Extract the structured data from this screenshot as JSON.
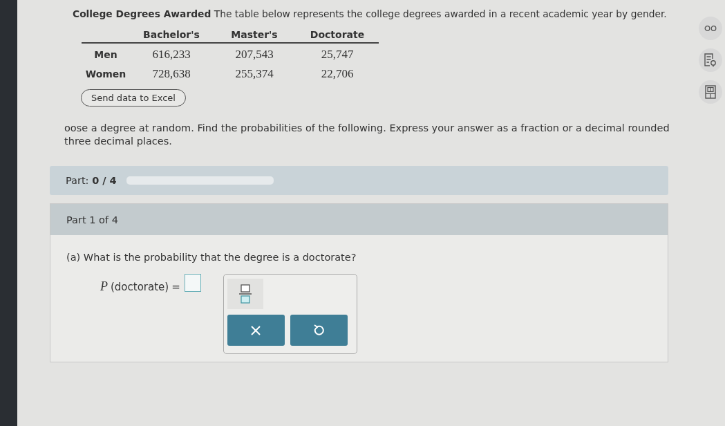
{
  "intro": {
    "title": "College Degrees Awarded",
    "text": "The table below represents the college degrees awarded in a recent academic year by gender."
  },
  "table": {
    "columns": [
      "Bachelor's",
      "Master's",
      "Doctorate"
    ],
    "rows": [
      {
        "label": "Men",
        "cells": [
          "616,233",
          "207,543",
          "25,747"
        ]
      },
      {
        "label": "Women",
        "cells": [
          "728,638",
          "255,374",
          "22,706"
        ]
      }
    ]
  },
  "excel_button": "Send data to Excel",
  "instructions": [
    "oose a degree at random. Find the probabilities of the following. Express your answer as a fraction or a decimal rounded",
    "three decimal places."
  ],
  "progress": {
    "label": "Part:",
    "value": "0 / 4",
    "level": 0
  },
  "part": {
    "title": "Part 1 of 4",
    "question": "(a) What is the probability that the degree is a doctorate?",
    "answer": {
      "function": "P",
      "argument": "(doctorate)",
      "equals": "="
    }
  }
}
